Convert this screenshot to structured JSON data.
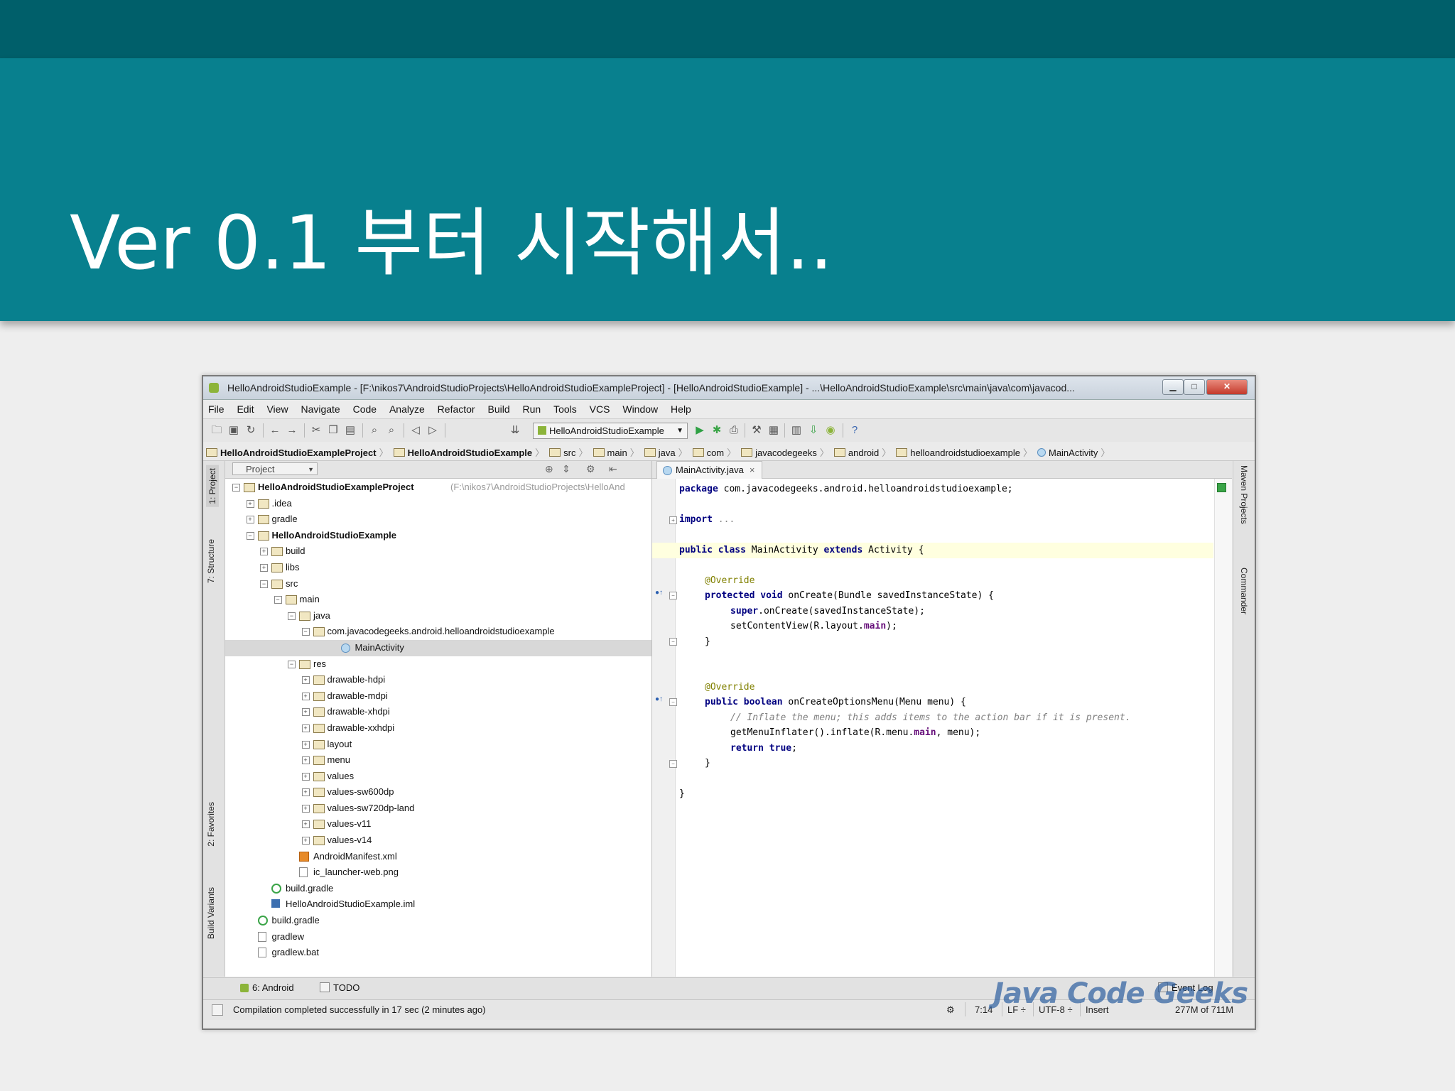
{
  "slide": {
    "title": "Ver 0.1 부터 시작해서.."
  },
  "window": {
    "title": "HelloAndroidStudioExample - [F:\\nikos7\\AndroidStudioProjects\\HelloAndroidStudioExampleProject] - [HelloAndroidStudioExample] - ...\\HelloAndroidStudioExample\\src\\main\\java\\com\\javacod...",
    "min_label": "▁",
    "max_label": "□",
    "close_label": "✕"
  },
  "menu": [
    "File",
    "Edit",
    "View",
    "Navigate",
    "Code",
    "Analyze",
    "Refactor",
    "Build",
    "Run",
    "Tools",
    "VCS",
    "Window",
    "Help"
  ],
  "toolbar": {
    "run_config": "HelloAndroidStudioExample"
  },
  "breadcrumbs": [
    "HelloAndroidStudioExampleProject",
    "HelloAndroidStudioExample",
    "src",
    "main",
    "java",
    "com",
    "javacodegeeks",
    "android",
    "helloandroidstudioexample",
    "MainActivity"
  ],
  "side_tabs": {
    "project": "1: Project",
    "structure": "7: Structure",
    "favorites": "2: Favorites",
    "build_variants": "Build Variants",
    "maven": "Maven Projects",
    "commander": "Commander"
  },
  "project_panel": {
    "selector": "Project",
    "tree": [
      {
        "label": "HelloAndroidStudioExampleProject",
        "path": "(F:\\nikos7\\AndroidStudioProjects\\HelloAnd",
        "depth": 0,
        "icon": "folder",
        "exp": "−",
        "bold": true
      },
      {
        "label": ".idea",
        "depth": 1,
        "icon": "folder",
        "exp": "+"
      },
      {
        "label": "gradle",
        "depth": 1,
        "icon": "folder",
        "exp": "+"
      },
      {
        "label": "HelloAndroidStudioExample",
        "depth": 1,
        "icon": "folder",
        "exp": "−",
        "bold": true
      },
      {
        "label": "build",
        "depth": 2,
        "icon": "folder",
        "exp": "+"
      },
      {
        "label": "libs",
        "depth": 2,
        "icon": "folder",
        "exp": "+"
      },
      {
        "label": "src",
        "depth": 2,
        "icon": "folder",
        "exp": "−"
      },
      {
        "label": "main",
        "depth": 3,
        "icon": "folder",
        "exp": "−"
      },
      {
        "label": "java",
        "depth": 4,
        "icon": "folder",
        "exp": "−"
      },
      {
        "label": "com.javacodegeeks.android.helloandroidstudioexample",
        "depth": 5,
        "icon": "pkg",
        "exp": "−"
      },
      {
        "label": "MainActivity",
        "depth": 7,
        "icon": "cls",
        "selected": true
      },
      {
        "label": "res",
        "depth": 4,
        "icon": "folder",
        "exp": "−"
      },
      {
        "label": "drawable-hdpi",
        "depth": 5,
        "icon": "pkg",
        "exp": "+"
      },
      {
        "label": "drawable-mdpi",
        "depth": 5,
        "icon": "pkg",
        "exp": "+"
      },
      {
        "label": "drawable-xhdpi",
        "depth": 5,
        "icon": "pkg",
        "exp": "+"
      },
      {
        "label": "drawable-xxhdpi",
        "depth": 5,
        "icon": "pkg",
        "exp": "+"
      },
      {
        "label": "layout",
        "depth": 5,
        "icon": "pkg",
        "exp": "+"
      },
      {
        "label": "menu",
        "depth": 5,
        "icon": "pkg",
        "exp": "+"
      },
      {
        "label": "values",
        "depth": 5,
        "icon": "pkg",
        "exp": "+"
      },
      {
        "label": "values-sw600dp",
        "depth": 5,
        "icon": "pkg",
        "exp": "+"
      },
      {
        "label": "values-sw720dp-land",
        "depth": 5,
        "icon": "pkg",
        "exp": "+"
      },
      {
        "label": "values-v11",
        "depth": 5,
        "icon": "pkg",
        "exp": "+"
      },
      {
        "label": "values-v14",
        "depth": 5,
        "icon": "pkg",
        "exp": "+"
      },
      {
        "label": "AndroidManifest.xml",
        "depth": 4,
        "icon": "xml"
      },
      {
        "label": "ic_launcher-web.png",
        "depth": 4,
        "icon": "file"
      },
      {
        "label": "build.gradle",
        "depth": 2,
        "icon": "gradle"
      },
      {
        "label": "HelloAndroidStudioExample.iml",
        "depth": 2,
        "icon": "iml"
      },
      {
        "label": "build.gradle",
        "depth": 1,
        "icon": "gradle"
      },
      {
        "label": "gradlew",
        "depth": 1,
        "icon": "file"
      },
      {
        "label": "gradlew.bat",
        "depth": 1,
        "icon": "file"
      }
    ]
  },
  "editor": {
    "tab": "MainActivity.java",
    "tab_close": "×",
    "code": {
      "package_kw": "package",
      "package_name": " com.javacodegeeks.android.helloandroidstudioexample;",
      "import_kw": "import",
      "import_fold": " ...",
      "class_decl_kw": "public class",
      "class_name": " MainActivity ",
      "extends_kw": "extends",
      "class_parent": " Activity {",
      "override1": "@Override",
      "oncreate_kw": "protected void",
      "oncreate_rest": " onCreate(Bundle savedInstanceState) {",
      "super_kw": "super",
      "super_rest": ".onCreate(savedInstanceState);",
      "setcontent_pre": "setContentView(R.layout.",
      "setcontent_field": "main",
      "setcontent_post": ");",
      "close1": "}",
      "override2": "@Override",
      "menu_kw": "public boolean",
      "menu_rest": " onCreateOptionsMenu(Menu menu) {",
      "comment": "// Inflate the menu; this adds items to the action bar if it is present.",
      "inflate_pre": "getMenuInflater().inflate(R.menu.",
      "inflate_field": "main",
      "inflate_post": ", menu);",
      "return_kw": "return true",
      "return_post": ";",
      "close2": "}",
      "close3": "}"
    }
  },
  "bottom_tabs": {
    "android": "6: Android",
    "todo": "TODO",
    "event_log": "Event Log"
  },
  "status": {
    "message": "Compilation completed successfully in 17 sec (2 minutes ago)",
    "position": "7:14",
    "line_sep": "LF ÷",
    "encoding": "UTF-8 ÷",
    "mode": "Insert",
    "memory": "277M of 711M"
  },
  "watermark": "Java Code Geeks",
  "colors": {
    "banner": "#08808e",
    "topbar": "#005f6a",
    "android_green": "#8cb43a"
  }
}
